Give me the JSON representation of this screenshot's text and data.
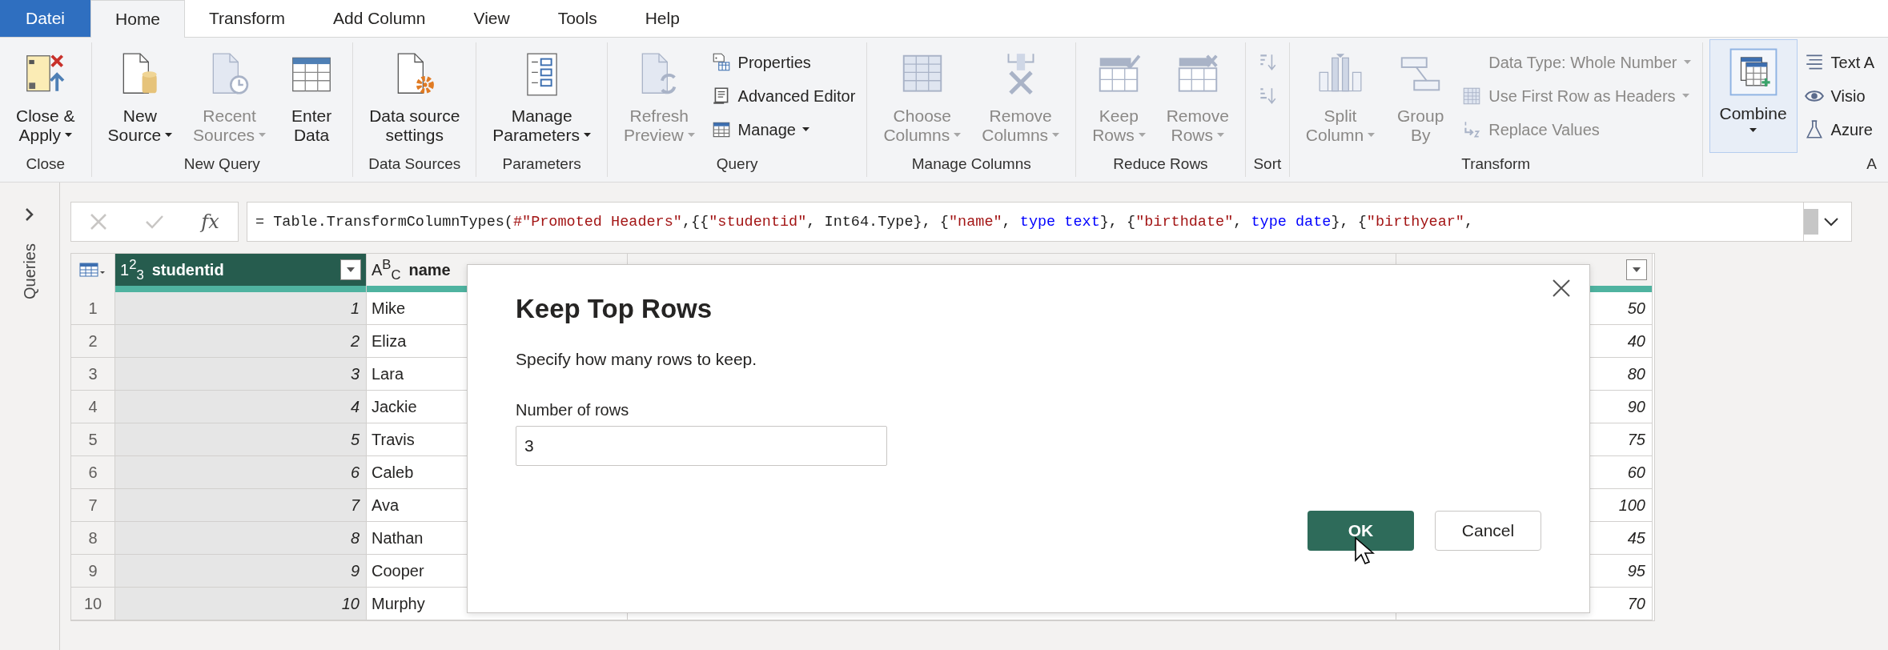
{
  "tabs": [
    {
      "label": "Datei",
      "kind": "file",
      "selected": false
    },
    {
      "label": "Home",
      "kind": "tab",
      "selected": true
    },
    {
      "label": "Transform",
      "kind": "tab",
      "selected": false
    },
    {
      "label": "Add Column",
      "kind": "tab",
      "selected": false
    },
    {
      "label": "View",
      "kind": "tab",
      "selected": false
    },
    {
      "label": "Tools",
      "kind": "tab",
      "selected": false
    },
    {
      "label": "Help",
      "kind": "tab",
      "selected": false
    }
  ],
  "ribbon": {
    "groups": [
      {
        "label": "Close",
        "items": [
          {
            "kind": "large",
            "lines": [
              "Close &",
              "Apply"
            ],
            "disabled": false,
            "dropdown": true,
            "hovered": false
          }
        ]
      },
      {
        "label": "New Query",
        "items": [
          {
            "kind": "large",
            "lines": [
              "New",
              "Source"
            ],
            "disabled": false,
            "dropdown": true,
            "hovered": false
          },
          {
            "kind": "large",
            "lines": [
              "Recent",
              "Sources"
            ],
            "disabled": true,
            "dropdown": true,
            "hovered": false
          },
          {
            "kind": "large",
            "lines": [
              "Enter",
              "Data"
            ],
            "disabled": false,
            "dropdown": false,
            "hovered": false
          }
        ]
      },
      {
        "label": "Data Sources",
        "items": [
          {
            "kind": "large",
            "lines": [
              "Data source",
              "settings"
            ],
            "disabled": false,
            "dropdown": false,
            "hovered": false
          }
        ]
      },
      {
        "label": "Parameters",
        "items": [
          {
            "kind": "large",
            "lines": [
              "Manage",
              "Parameters"
            ],
            "disabled": false,
            "dropdown": true,
            "hovered": false
          }
        ]
      },
      {
        "label": "Query",
        "items": [
          {
            "kind": "large",
            "lines": [
              "Refresh",
              "Preview"
            ],
            "disabled": true,
            "dropdown": true,
            "hovered": false
          },
          {
            "kind": "stack",
            "items": [
              {
                "label": "Properties",
                "disabled": false,
                "dropdown": false
              },
              {
                "label": "Advanced Editor",
                "disabled": false,
                "dropdown": false
              },
              {
                "label": "Manage",
                "disabled": false,
                "dropdown": true
              }
            ]
          }
        ]
      },
      {
        "label": "Manage Columns",
        "items": [
          {
            "kind": "large",
            "lines": [
              "Choose",
              "Columns"
            ],
            "disabled": true,
            "dropdown": true,
            "hovered": false
          },
          {
            "kind": "large",
            "lines": [
              "Remove",
              "Columns"
            ],
            "disabled": true,
            "dropdown": true,
            "hovered": false
          }
        ]
      },
      {
        "label": "Reduce Rows",
        "items": [
          {
            "kind": "large",
            "lines": [
              "Keep",
              "Rows"
            ],
            "disabled": true,
            "dropdown": true,
            "hovered": false
          },
          {
            "kind": "large",
            "lines": [
              "Remove",
              "Rows"
            ],
            "disabled": true,
            "dropdown": true,
            "hovered": false
          }
        ]
      },
      {
        "label": "Sort",
        "items": [
          {
            "kind": "icons",
            "items": [
              {
                "disabled": true
              },
              {
                "disabled": true
              }
            ]
          }
        ]
      },
      {
        "label": "Transform",
        "items": [
          {
            "kind": "large",
            "lines": [
              "Split",
              "Column"
            ],
            "disabled": true,
            "dropdown": true,
            "hovered": false
          },
          {
            "kind": "large",
            "lines": [
              "Group",
              "By"
            ],
            "disabled": true,
            "dropdown": false,
            "hovered": false
          },
          {
            "kind": "stack",
            "items": [
              {
                "label": "Data Type: Whole Number",
                "disabled": true,
                "dropdown": true
              },
              {
                "label": "Use First Row as Headers",
                "disabled": true,
                "dropdown": true
              },
              {
                "label": "Replace Values",
                "disabled": true,
                "dropdown": false
              }
            ]
          }
        ]
      },
      {
        "label": "A",
        "items": [
          {
            "kind": "large",
            "lines": [
              "Combine"
            ],
            "disabled": false,
            "dropdown": true,
            "hovered": true
          },
          {
            "kind": "stack",
            "items": [
              {
                "label": "Text A",
                "disabled": false,
                "dropdown": false
              },
              {
                "label": "Visio",
                "disabled": false,
                "dropdown": false
              },
              {
                "label": "Azure",
                "disabled": false,
                "dropdown": false
              }
            ]
          }
        ]
      }
    ]
  },
  "queries_pane": {
    "label": "Queries"
  },
  "formula_bar": {
    "fx_label": "fx",
    "tokens": [
      {
        "kind": "plain",
        "text": "= Table.TransformColumnTypes("
      },
      {
        "kind": "string",
        "text": "#\"Promoted Headers\""
      },
      {
        "kind": "plain",
        "text": ",{{"
      },
      {
        "kind": "string",
        "text": "\"studentid\""
      },
      {
        "kind": "plain",
        "text": ", Int64.Type}, {"
      },
      {
        "kind": "string",
        "text": "\"name\""
      },
      {
        "kind": "plain",
        "text": ", "
      },
      {
        "kind": "keyword",
        "text": "type text"
      },
      {
        "kind": "plain",
        "text": "}, {"
      },
      {
        "kind": "string",
        "text": "\"birthdate\""
      },
      {
        "kind": "plain",
        "text": ", "
      },
      {
        "kind": "keyword",
        "text": "type date"
      },
      {
        "kind": "plain",
        "text": "}, {"
      },
      {
        "kind": "string",
        "text": "\"birthyear\""
      },
      {
        "kind": "plain",
        "text": ","
      }
    ]
  },
  "table": {
    "columns": [
      {
        "type_label": "1$^{2}$$_{3}$",
        "name": "studentid",
        "selected": true,
        "filter": true
      },
      {
        "type_label": "A$^{B}$$_{C}$",
        "name": "name",
        "selected": false,
        "filter": false
      },
      {
        "selected": false,
        "filter": true
      }
    ],
    "rows": [
      {
        "number": "1",
        "cells": [
          "1",
          "Mike",
          "50"
        ]
      },
      {
        "number": "2",
        "cells": [
          "2",
          "Eliza",
          "40"
        ]
      },
      {
        "number": "3",
        "cells": [
          "3",
          "Lara",
          "80"
        ]
      },
      {
        "number": "4",
        "cells": [
          "4",
          "Jackie",
          "90"
        ]
      },
      {
        "number": "5",
        "cells": [
          "5",
          "Travis",
          "75"
        ]
      },
      {
        "number": "6",
        "cells": [
          "6",
          "Caleb",
          "60"
        ]
      },
      {
        "number": "7",
        "cells": [
          "7",
          "Ava",
          "100"
        ]
      },
      {
        "number": "8",
        "cells": [
          "8",
          "Nathan",
          "45"
        ]
      },
      {
        "number": "9",
        "cells": [
          "9",
          "Cooper",
          "95"
        ]
      },
      {
        "number": "10",
        "cells": [
          "10",
          "Murphy",
          "70"
        ]
      }
    ]
  },
  "dialog": {
    "title": "Keep Top Rows",
    "message": "Specify how many rows to keep.",
    "field_label": "Number of rows",
    "value": "3",
    "buttons": [
      {
        "label": "OK",
        "kind": "primary",
        "hovered": true
      },
      {
        "label": "Cancel",
        "kind": "secondary",
        "hovered": false
      }
    ]
  }
}
